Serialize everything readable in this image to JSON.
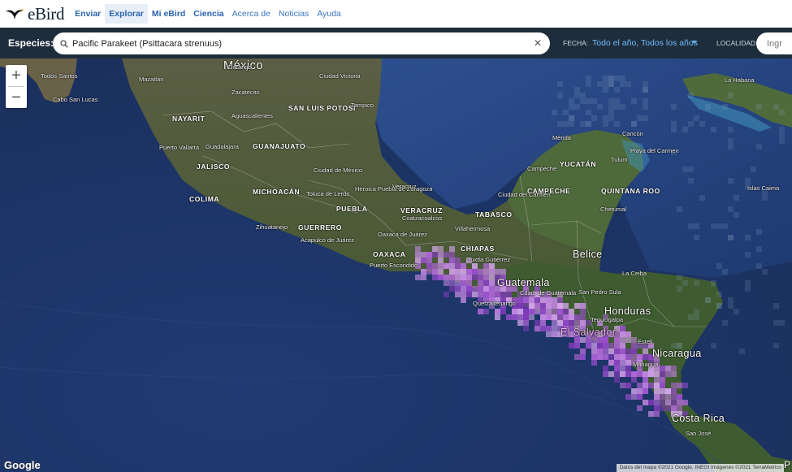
{
  "nav": {
    "brand": "eBird",
    "links": [
      {
        "label": "Enviar",
        "bold": true,
        "active": false
      },
      {
        "label": "Explorar",
        "bold": true,
        "active": true
      },
      {
        "label": "Mi eBird",
        "bold": true,
        "active": false
      },
      {
        "label": "Ciencia",
        "bold": true,
        "active": false
      },
      {
        "label": "Acerca de",
        "bold": false,
        "active": false
      },
      {
        "label": "Noticias",
        "bold": false,
        "active": false
      },
      {
        "label": "Ayuda",
        "bold": false,
        "active": false
      }
    ]
  },
  "search": {
    "species_label": "Especies:",
    "species_value": "Pacific Parakeet (Psittacara strenuus)",
    "clear_icon": "close-icon",
    "fecha_label": "FECHA:",
    "fecha_value": "Todo el año,  Todos los años",
    "localidad_label": "LOCALIDAD:",
    "localidad_placeholder": "Ingr"
  },
  "map": {
    "zoom_in": "+",
    "zoom_out": "−",
    "google": "Google",
    "attribution": "Datos del mapa ©2021 Google, INEGI Imágenes ©2021 TerraMetrics",
    "edge_letter": "P",
    "colors": {
      "ocean": "#1d3567",
      "land": "#4b5c3a",
      "range": "#b06ad6"
    },
    "labels": [
      {
        "text": "México",
        "type": "country-big"
      },
      {
        "text": "Todos Santos",
        "type": "city"
      },
      {
        "text": "Cabo San Lucas",
        "type": "city"
      },
      {
        "text": "Mazatlán",
        "type": "city"
      },
      {
        "text": "Durango",
        "type": "city"
      },
      {
        "text": "Zacatecas",
        "type": "city"
      },
      {
        "text": "Ciudad Victoria",
        "type": "city"
      },
      {
        "text": "SAN LUIS POTOSÍ",
        "type": "state"
      },
      {
        "text": "Tampico",
        "type": "city"
      },
      {
        "text": "NAYARIT",
        "type": "state"
      },
      {
        "text": "Aguascalientes",
        "type": "city"
      },
      {
        "text": "Puerto Vallarta",
        "type": "city"
      },
      {
        "text": "Guadalajara",
        "type": "city"
      },
      {
        "text": "GUANAJUATO",
        "type": "state"
      },
      {
        "text": "JALISCO",
        "type": "state"
      },
      {
        "text": "Ciudad de México",
        "type": "city"
      },
      {
        "text": "COLIMA",
        "type": "state"
      },
      {
        "text": "MICHOACÁN",
        "type": "state"
      },
      {
        "text": "Toluca de Lerdo",
        "type": "city"
      },
      {
        "text": "Heroica Puebla de Zaragoza",
        "type": "city"
      },
      {
        "text": "Veracruz",
        "type": "city"
      },
      {
        "text": "PUEBLA",
        "type": "state"
      },
      {
        "text": "VERACRUZ",
        "type": "state"
      },
      {
        "text": "Coatzacoalcos",
        "type": "city"
      },
      {
        "text": "Zihuatanejo",
        "type": "city"
      },
      {
        "text": "GUERRERO",
        "type": "state"
      },
      {
        "text": "Acapulco de Juárez",
        "type": "city"
      },
      {
        "text": "Oaxaca de Juárez",
        "type": "city"
      },
      {
        "text": "OAXACA",
        "type": "state"
      },
      {
        "text": "Puerto Escondido",
        "type": "city"
      },
      {
        "text": "TABASCO",
        "type": "state"
      },
      {
        "text": "Villahermosa",
        "type": "city"
      },
      {
        "text": "CHIAPAS",
        "type": "state"
      },
      {
        "text": "Tuxtla Gutiérrez",
        "type": "city"
      },
      {
        "text": "Mérida",
        "type": "city"
      },
      {
        "text": "YUCATÁN",
        "type": "state"
      },
      {
        "text": "Campeche",
        "type": "city"
      },
      {
        "text": "CAMPECHE",
        "type": "state"
      },
      {
        "text": "Ciudad del Carmen",
        "type": "city"
      },
      {
        "text": "QUINTANA ROO",
        "type": "state"
      },
      {
        "text": "Cancún",
        "type": "city"
      },
      {
        "text": "Playa del Carmen",
        "type": "city"
      },
      {
        "text": "Tulum",
        "type": "city"
      },
      {
        "text": "Chetumal",
        "type": "city"
      },
      {
        "text": "La Habana",
        "type": "city"
      },
      {
        "text": "Islas Caima",
        "type": "city"
      },
      {
        "text": "Belice",
        "type": "country"
      },
      {
        "text": "Guatemala",
        "type": "country"
      },
      {
        "text": "Cdad. de Guatemala",
        "type": "city"
      },
      {
        "text": "Quetzaltenango",
        "type": "city"
      },
      {
        "text": "San Pedro Sula",
        "type": "city"
      },
      {
        "text": "La Ceiba",
        "type": "city"
      },
      {
        "text": "Honduras",
        "type": "country"
      },
      {
        "text": "Tegucigalpa",
        "type": "city"
      },
      {
        "text": "El Salvador",
        "type": "country-pink"
      },
      {
        "text": "Estelí",
        "type": "city"
      },
      {
        "text": "Nicaragua",
        "type": "country"
      },
      {
        "text": "Managua",
        "type": "city"
      },
      {
        "text": "Costa Rica",
        "type": "country"
      },
      {
        "text": "San José",
        "type": "city"
      }
    ]
  }
}
